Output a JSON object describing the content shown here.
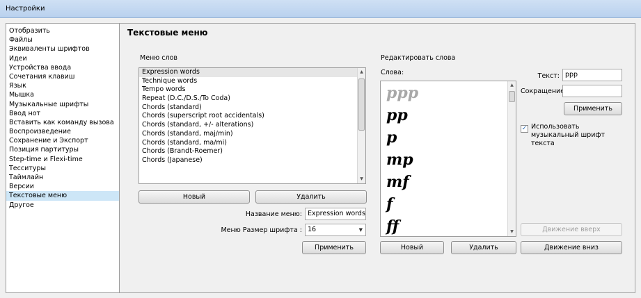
{
  "window": {
    "title": "Настройки"
  },
  "sidebar": {
    "items": [
      "Отобразить",
      "Файлы",
      "Эквиваленты шрифтов",
      "Идеи",
      "Устройства ввода",
      "Сочетания клавиш",
      "Язык",
      "Мышка",
      "Музыкальные шрифты",
      "Ввод нот",
      "Вставить как команду вызова",
      "Воспроизведение",
      "Сохранение и Экспорт",
      "Позиция партитуры",
      "Step-time и Flexi-time",
      "Тесситуры",
      "Таймлайн",
      "Версии",
      "Текстовые меню",
      "Другое"
    ],
    "selected_index": 18
  },
  "page": {
    "title": "Текстовые меню"
  },
  "word_menus": {
    "label": "Меню слов",
    "items": [
      "Expression words",
      "Technique words",
      "Tempo words",
      "Repeat (D.C./D.S./To Coda)",
      "Chords (standard)",
      "Chords (superscript root accidentals)",
      "Chords (standard, +/- alterations)",
      "Chords (standard, maj/min)",
      "Chords (standard, ma/mi)",
      "Chords (Brandt-Roemer)",
      "Chords (Japanese)"
    ],
    "selected_index": 0,
    "new_button": "Новый",
    "delete_button": "Удалить",
    "menu_name_label": "Название меню:",
    "menu_name_value": "Expression words",
    "font_size_label": "Меню Размер шрифта :",
    "font_size_value": "16",
    "apply_button": "Применить"
  },
  "edit_words": {
    "label": "Редактировать слова",
    "words_label": "Слова:",
    "words": [
      "ppp",
      "pp",
      "p",
      "mp",
      "mf",
      "f",
      "ff"
    ],
    "selected_index": 0,
    "text_label": "Текст:",
    "text_value": "ppp",
    "abbrev_label": "Сокращение:",
    "abbrev_value": "",
    "apply_button": "Применить",
    "use_music_font_checked": true,
    "use_music_font_label": "Использовать музыкальный шрифт текста",
    "move_up_button": "Движение вверх",
    "move_down_button": "Движение вниз",
    "new_button": "Новый",
    "delete_button": "Удалить"
  }
}
